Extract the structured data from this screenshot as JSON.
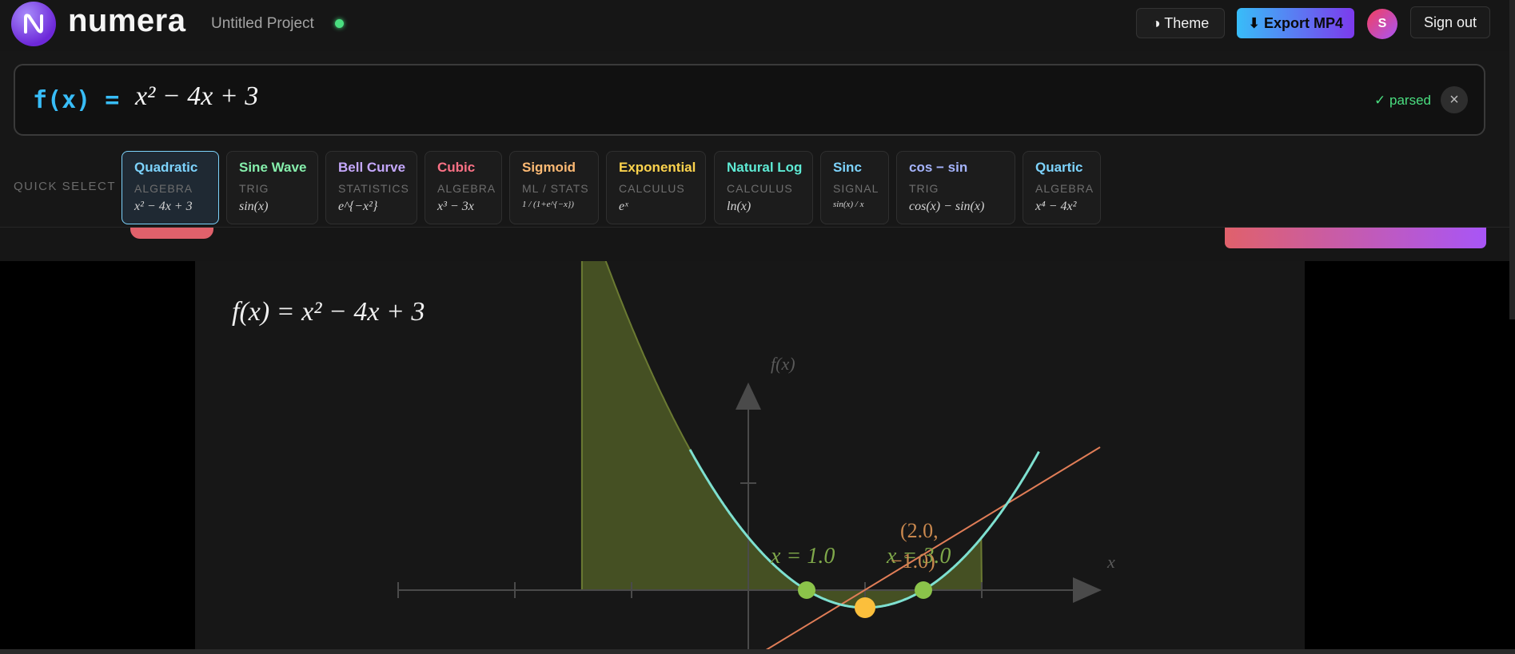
{
  "header": {
    "brand": "numera",
    "project_name": "Untitled Project",
    "theme_label": "◑ Theme",
    "export_label": "⬇ Export MP4",
    "avatar_initial": "S",
    "signout_label": "Sign out"
  },
  "formula": {
    "prefix": "f(x) =",
    "expression": "x² − 4x + 3",
    "status": "✓ parsed",
    "clear_icon": "×"
  },
  "quick_select": {
    "label": "QUICK SELECT",
    "presets": [
      {
        "title": "Quadratic",
        "category": "ALGEBRA",
        "formula": "x² − 4x + 3",
        "color": "#7dd3fc"
      },
      {
        "title": "Sine Wave",
        "category": "TRIG",
        "formula": "sin(x)",
        "color": "#86efac"
      },
      {
        "title": "Bell Curve",
        "category": "STATISTICS",
        "formula": "e^{−x²}",
        "color": "#c4a7fb"
      },
      {
        "title": "Cubic",
        "category": "ALGEBRA",
        "formula": "x³ − 3x",
        "color": "#fb7185"
      },
      {
        "title": "Sigmoid",
        "category": "ML / STATS",
        "formula": "1 / (1+e^{−x})",
        "color": "#fdba74"
      },
      {
        "title": "Exponential",
        "category": "CALCULUS",
        "formula": "eˣ",
        "color": "#fcd34d"
      },
      {
        "title": "Natural Log",
        "category": "CALCULUS",
        "formula": "ln(x)",
        "color": "#5eead4"
      },
      {
        "title": "Sinc",
        "category": "SIGNAL",
        "formula": "sin(x) / x",
        "color": "#7dd3fc"
      },
      {
        "title": "cos − sin",
        "category": "TRIG",
        "formula": "cos(x) − sin(x)",
        "color": "#a5b4fc"
      },
      {
        "title": "Quartic",
        "category": "ALGEBRA",
        "formula": "x⁴ − 4x²",
        "color": "#7dd3fc"
      }
    ]
  },
  "canvas": {
    "title": "f(x) = x² − 4x + 3",
    "y_axis_label": "f(x)",
    "x_axis_label": "x",
    "root1_label": "x = 1.0",
    "root2_label": "x = 3.0",
    "vertex_label_line1": "(2.0,",
    "vertex_label_line2": "−1.0)",
    "colors": {
      "curve": "#7ee0d0",
      "area": "#4d5a26",
      "tangent": "#e07d57",
      "roots": "#8bc34a",
      "vertex": "#fbbf3c",
      "vertex_label": "#e0a060"
    }
  }
}
